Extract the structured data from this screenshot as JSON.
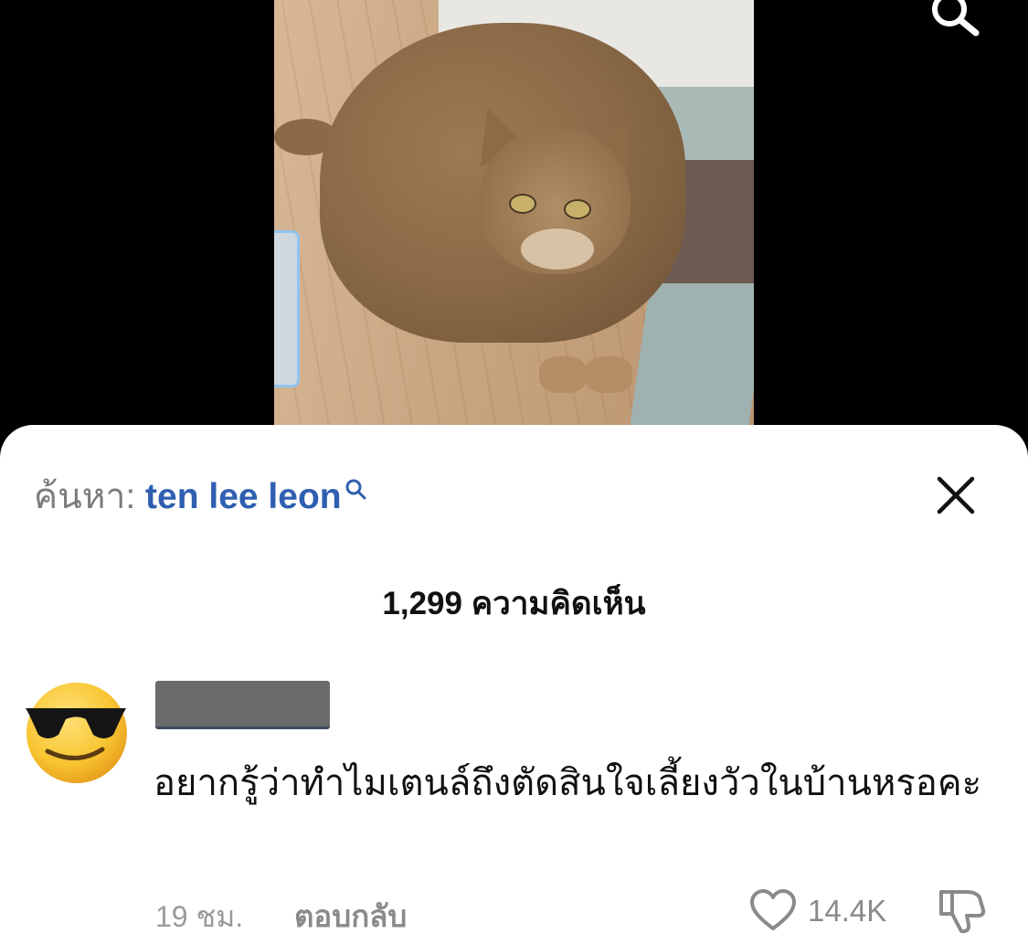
{
  "header": {
    "search_prefix": "ค้นหา:",
    "search_query": "ten lee leon"
  },
  "comments": {
    "count_label": "1,299 ความคิดเห็น",
    "items": [
      {
        "avatar": "smiling-face-with-sunglasses-emoji",
        "text": "อยากรู้ว่าทำไมเตนล์ถึงตัดสินใจเลี้ยงวัวในบ้านหรอคะ",
        "time": "19 ชม.",
        "reply_label": "ตอบกลับ",
        "likes": "14.4K"
      }
    ]
  },
  "icons": {
    "top_search": "search-icon",
    "inline_search": "search-icon",
    "close": "close-icon",
    "like": "heart-icon",
    "dislike": "thumbs-down-icon"
  },
  "colors": {
    "query": "#2f5fb0",
    "muted": "#8a8a8a",
    "background_video": "#000000"
  }
}
